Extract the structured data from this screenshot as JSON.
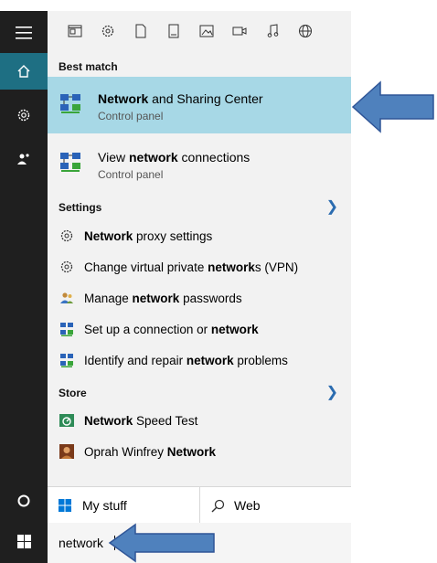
{
  "filters": {
    "icons": [
      "app-icon",
      "settings-icon",
      "document-icon",
      "folder-icon",
      "photo-icon",
      "video-icon",
      "music-icon",
      "web-icon"
    ]
  },
  "rail": {
    "items": [
      "hamburger-icon",
      "home-icon",
      "settings-icon",
      "people-icon",
      "cortana-icon",
      "windows-icon"
    ]
  },
  "best_match": {
    "header": "Best match",
    "title_bold": "Network",
    "title_rest": " and Sharing Center",
    "subtitle": "Control panel"
  },
  "second_result": {
    "title_prefix": "View ",
    "title_bold": "network",
    "title_rest": " connections",
    "subtitle": "Control panel"
  },
  "settings_section": {
    "header": "Settings",
    "items": [
      {
        "pre": "",
        "bold": "Network",
        "post": " proxy settings",
        "icon": "gear-icon"
      },
      {
        "pre": "Change virtual private ",
        "bold": "network",
        "post": "s (VPN)",
        "icon": "gear-icon"
      },
      {
        "pre": "Manage ",
        "bold": "network",
        "post": " passwords",
        "icon": "users-icon"
      },
      {
        "pre": "Set up a connection or ",
        "bold": "network",
        "post": "",
        "icon": "network-icon"
      },
      {
        "pre": "Identify and repair ",
        "bold": "network",
        "post": " problems",
        "icon": "network-icon"
      }
    ]
  },
  "store_section": {
    "header": "Store",
    "items": [
      {
        "pre": "",
        "bold": "Network",
        "post": " Speed Test",
        "icon": "speedtest-icon"
      },
      {
        "pre": "Oprah Winfrey ",
        "bold": "Network",
        "post": "",
        "icon": "oprah-icon"
      }
    ]
  },
  "bottom": {
    "my_stuff": "My stuff",
    "web": "Web"
  },
  "search": {
    "value": "network"
  },
  "colors": {
    "accent": "#1e6f83",
    "highlight": "#a7d8e6",
    "arrow": "#4f81bd",
    "arrow_border": "#2f5597"
  }
}
